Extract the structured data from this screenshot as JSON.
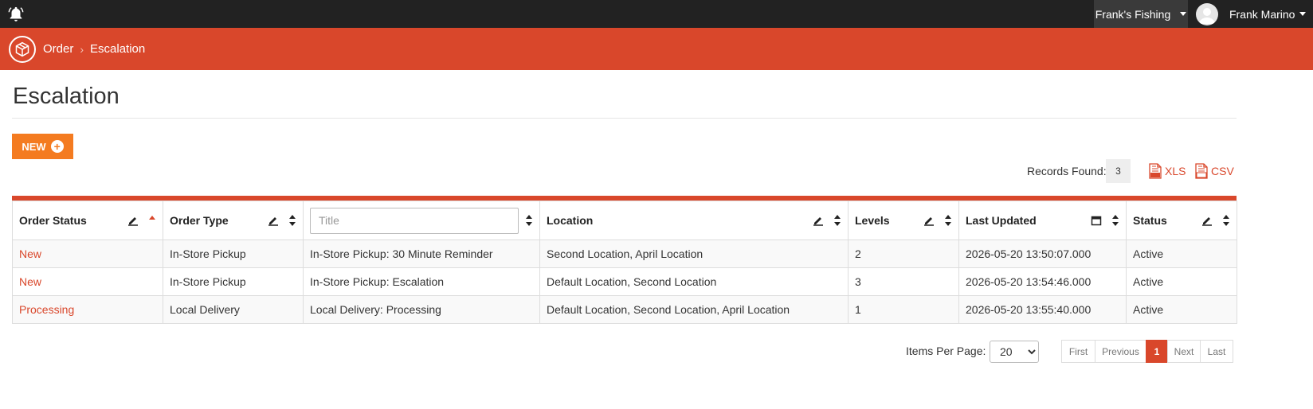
{
  "topbar": {
    "store_name": "Frank's Fishing",
    "user_name": "Frank Marino"
  },
  "breadcrumb": {
    "parent": "Order",
    "current": "Escalation"
  },
  "page": {
    "title": "Escalation",
    "new_button": "NEW"
  },
  "records": {
    "label": "Records Found:",
    "count": "3",
    "xls": "XLS",
    "csv": "CSV"
  },
  "table": {
    "columns": {
      "order_status": "Order Status",
      "order_type": "Order Type",
      "title_placeholder": "Title",
      "location": "Location",
      "levels": "Levels",
      "last_updated": "Last Updated",
      "status": "Status"
    },
    "rows": [
      {
        "order_status": "New",
        "order_type": "In-Store Pickup",
        "title": "In-Store Pickup: 30 Minute Reminder",
        "location": "Second Location, April Location",
        "levels": "2",
        "last_updated": "2026-05-20 13:50:07.000",
        "status": "Active"
      },
      {
        "order_status": "New",
        "order_type": "In-Store Pickup",
        "title": "In-Store Pickup: Escalation",
        "location": "Default Location, Second Location",
        "levels": "3",
        "last_updated": "2026-05-20 13:54:46.000",
        "status": "Active"
      },
      {
        "order_status": "Processing",
        "order_type": "Local Delivery",
        "title": "Local Delivery: Processing",
        "location": "Default Location, Second Location, April Location",
        "levels": "1",
        "last_updated": "2026-05-20 13:55:40.000",
        "status": "Active"
      }
    ]
  },
  "pagination": {
    "items_per_page_label": "Items Per Page:",
    "items_per_page": "20",
    "first": "First",
    "previous": "Previous",
    "current": "1",
    "next": "Next",
    "last": "Last"
  },
  "colors": {
    "brand": "#d9472b",
    "accent": "#f47b20",
    "topbar": "#222222"
  }
}
